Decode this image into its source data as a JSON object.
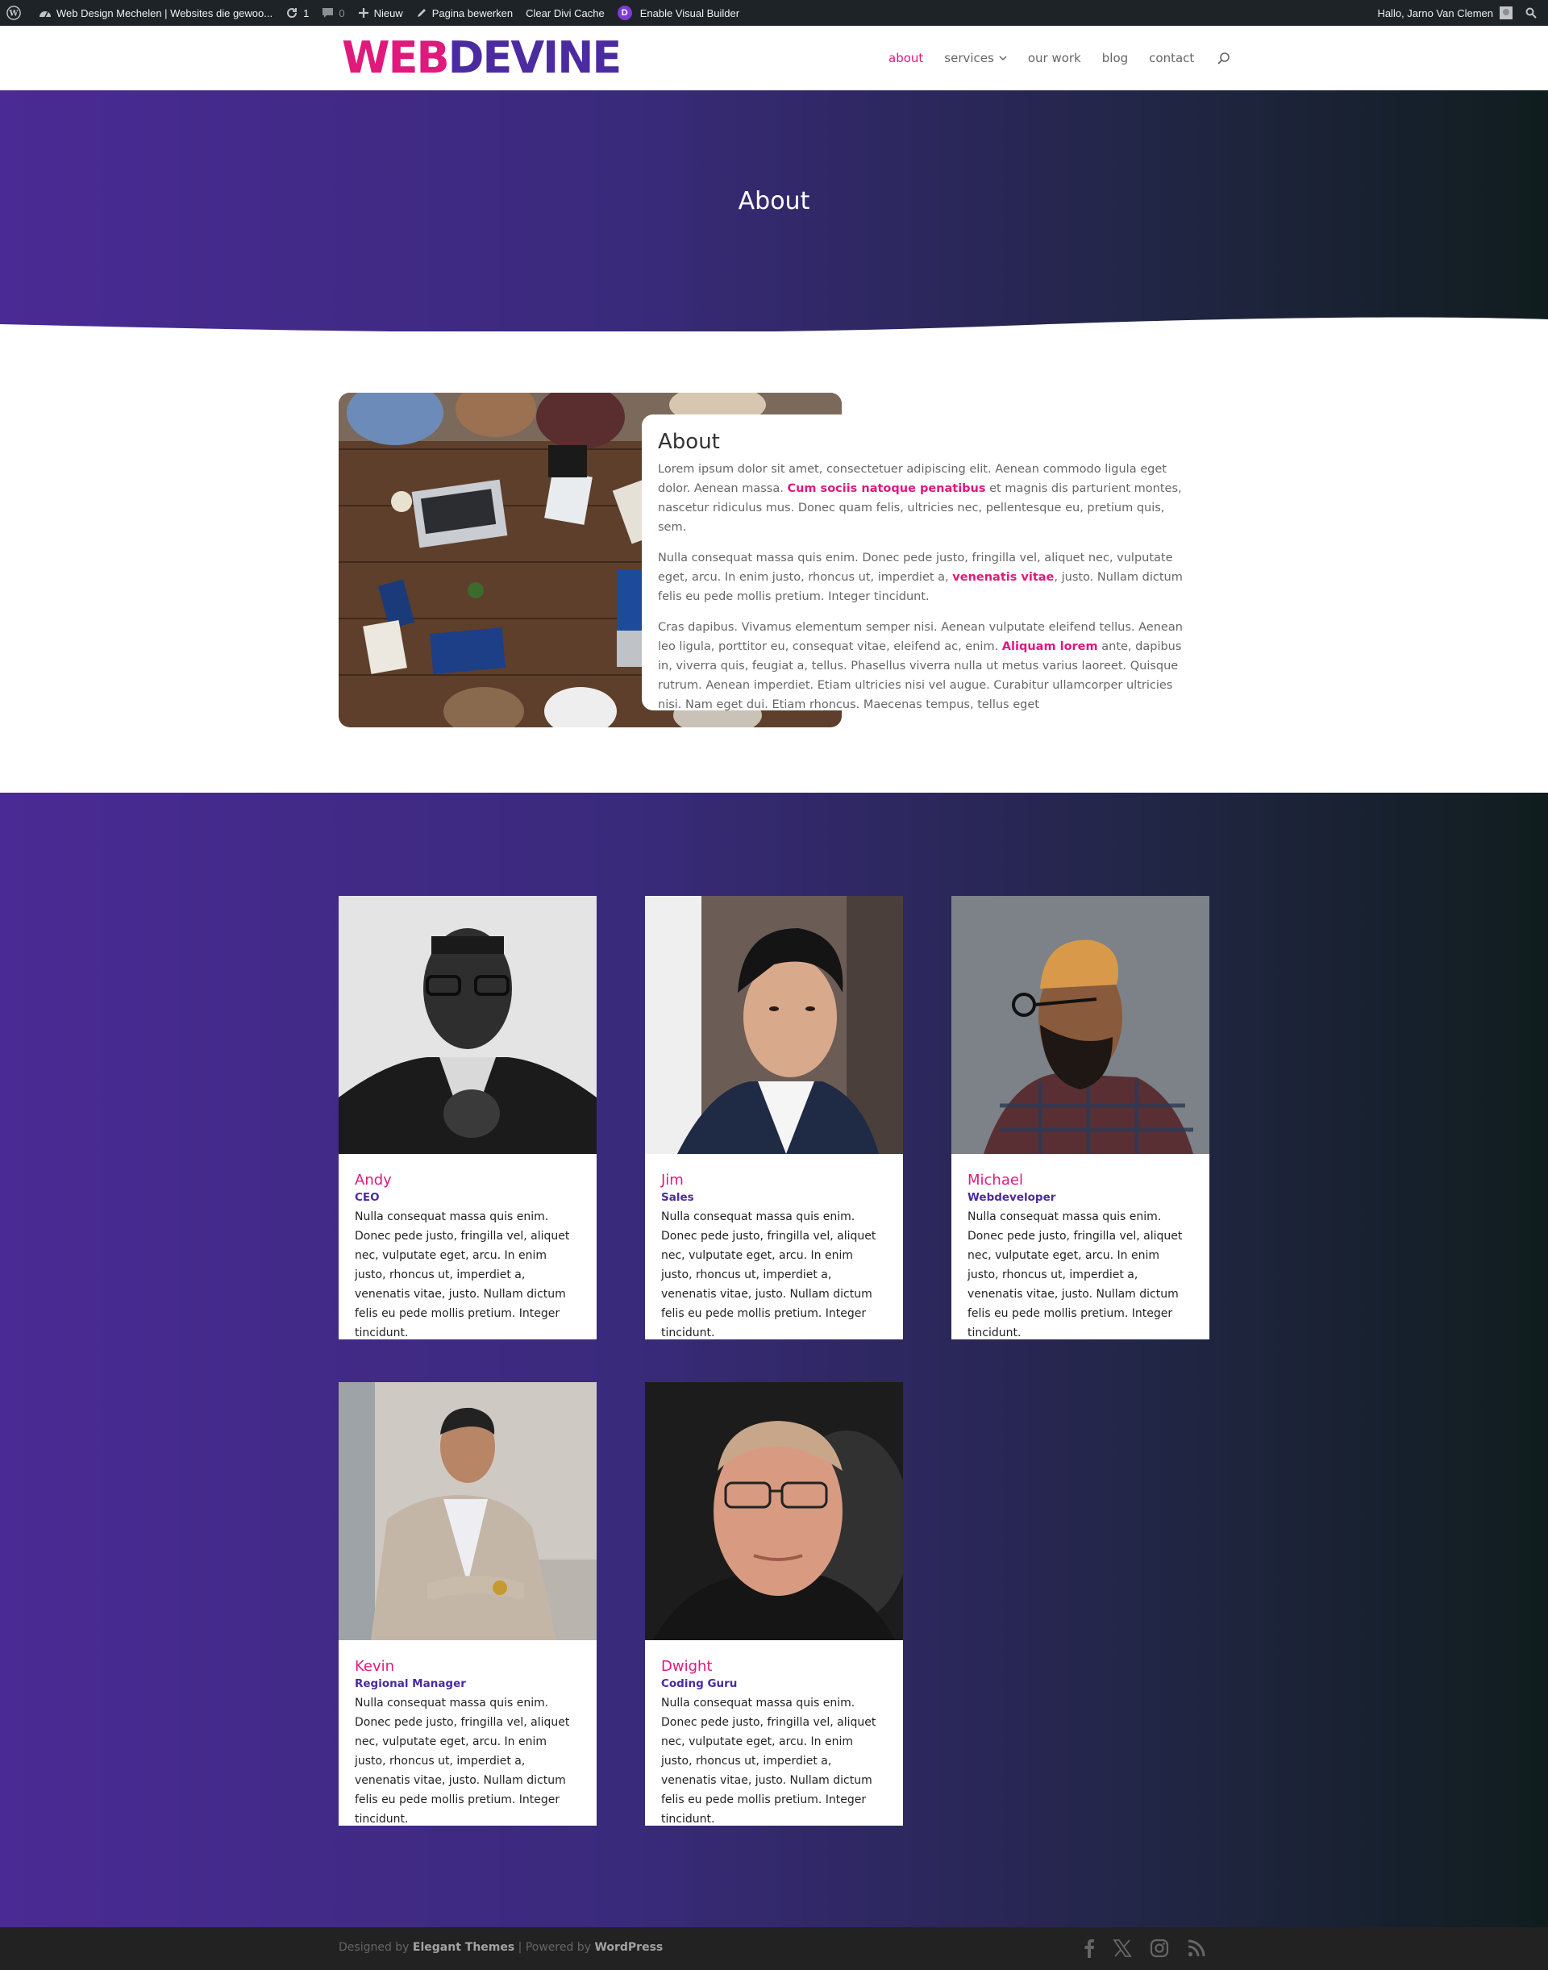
{
  "admin_bar": {
    "site_title": "Web Design Mechelen | Websites die gewoo...",
    "updates_count": "1",
    "comments_count": "0",
    "new_label": "Nieuw",
    "edit_label": "Pagina bewerken",
    "clear_cache_label": "Clear Divi Cache",
    "visual_builder_label": "Enable Visual Builder",
    "greeting": "Hallo, Jarno Van Clemen"
  },
  "header": {
    "logo_part1": "WEB",
    "logo_part2": "DEVINE",
    "nav": [
      {
        "label": "about",
        "active": true
      },
      {
        "label": "services",
        "has_dropdown": true
      },
      {
        "label": "our work"
      },
      {
        "label": "blog"
      },
      {
        "label": "contact"
      }
    ]
  },
  "hero": {
    "title": "About"
  },
  "about": {
    "heading": "About",
    "p1_a": "Lorem ipsum dolor sit amet, consectetuer adipiscing elit. Aenean commodo ligula eget dolor. Aenean massa. ",
    "p1_bold": "Cum sociis natoque penatibus",
    "p1_b": " et magnis dis parturient montes, nascetur ridiculus mus. Donec quam felis, ultricies nec, pellentesque eu, pretium quis, sem.",
    "p2_a": "Nulla consequat massa quis enim. Donec pede justo, fringilla vel, aliquet nec, vulputate eget, arcu. In enim justo, rhoncus ut, imperdiet a, ",
    "p2_bold": "venenatis vitae",
    "p2_b": ", justo. Nullam dictum felis eu pede mollis pretium. Integer tincidunt.",
    "p3_a": "Cras dapibus. Vivamus elementum semper nisi. Aenean vulputate eleifend tellus. Aenean leo ligula, porttitor eu, consequat vitae, eleifend ac, enim. ",
    "p3_bold": "Aliquam lorem",
    "p3_b": " ante, dapibus in, viverra quis, feugiat a, tellus. Phasellus viverra nulla ut metus varius laoreet. Quisque rutrum. Aenean imperdiet. Etiam ultricies nisi vel augue. Curabitur ullamcorper ultricies nisi. Nam eget dui. Etiam rhoncus. Maecenas tempus, tellus eget"
  },
  "team": [
    {
      "name": "Andy",
      "role": "CEO",
      "bio": "Nulla consequat massa quis enim. Donec pede justo, fringilla vel, aliquet nec, vulputate eget, arcu. In enim justo, rhoncus ut, imperdiet a, venenatis vitae, justo. Nullam dictum felis eu pede mollis pretium. Integer tincidunt."
    },
    {
      "name": "Jim",
      "role": "Sales",
      "bio": "Nulla consequat massa quis enim. Donec pede justo, fringilla vel, aliquet nec, vulputate eget, arcu. In enim justo, rhoncus ut, imperdiet a, venenatis vitae, justo. Nullam dictum felis eu pede mollis pretium. Integer tincidunt."
    },
    {
      "name": "Michael",
      "role": "Webdeveloper",
      "bio": "Nulla consequat massa quis enim. Donec pede justo, fringilla vel, aliquet nec, vulputate eget, arcu. In enim justo, rhoncus ut, imperdiet a, venenatis vitae, justo. Nullam dictum felis eu pede mollis pretium. Integer tincidunt."
    },
    {
      "name": "Kevin",
      "role": "Regional Manager",
      "bio": "Nulla consequat massa quis enim. Donec pede justo, fringilla vel, aliquet nec, vulputate eget, arcu. In enim justo, rhoncus ut, imperdiet a, venenatis vitae, justo. Nullam dictum felis eu pede mollis pretium. Integer tincidunt."
    },
    {
      "name": "Dwight",
      "role": "Coding Guru",
      "bio": "Nulla consequat massa quis enim. Donec pede justo, fringilla vel, aliquet nec, vulputate eget, arcu. In enim justo, rhoncus ut, imperdiet a, venenatis vitae, justo. Nullam dictum felis eu pede mollis pretium. Integer tincidunt."
    }
  ],
  "footer": {
    "designed_by": "Designed by ",
    "elegant": "Elegant Themes",
    "powered": " | Powered by ",
    "wordpress": "WordPress",
    "social_icons": [
      "facebook-icon",
      "x-icon",
      "instagram-icon",
      "rss-icon"
    ]
  },
  "colors": {
    "accent": "#e0197d",
    "brand_purple": "#4b2ba0",
    "gradient_dark": "#101d1e"
  }
}
